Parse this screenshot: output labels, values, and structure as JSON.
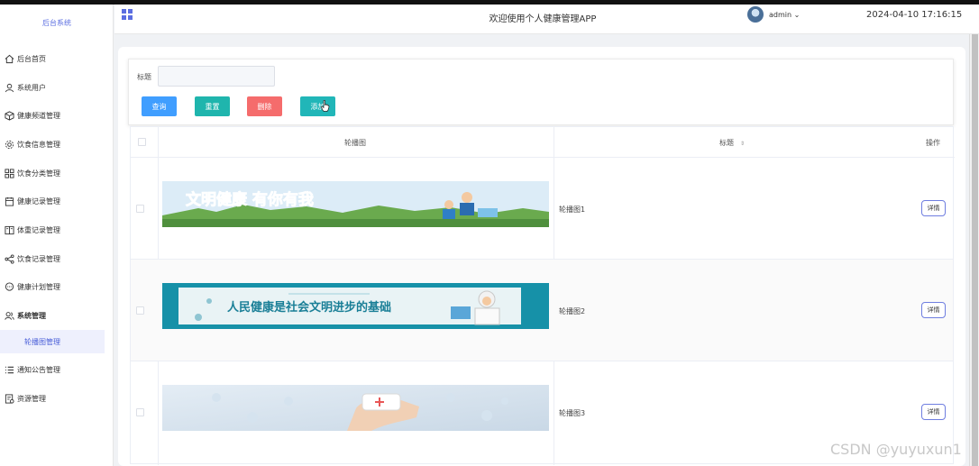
{
  "sidebar": {
    "logo": "后台系统",
    "items": [
      {
        "label": "后台首页",
        "icon": "home-icon"
      },
      {
        "label": "系统用户",
        "icon": "user-icon"
      },
      {
        "label": "健康频道管理",
        "icon": "cube-icon"
      },
      {
        "label": "饮食信息管理",
        "icon": "gear-icon"
      },
      {
        "label": "饮食分类管理",
        "icon": "grid-icon"
      },
      {
        "label": "健康记录管理",
        "icon": "notebook-icon"
      },
      {
        "label": "体重记录管理",
        "icon": "book-icon"
      },
      {
        "label": "饮食记录管理",
        "icon": "share-icon"
      },
      {
        "label": "健康计划管理",
        "icon": "chat-icon"
      },
      {
        "label": "系统管理",
        "icon": "users-icon"
      },
      {
        "label": "轮播图管理",
        "icon": ""
      },
      {
        "label": "通知公告管理",
        "icon": "list-icon"
      },
      {
        "label": "资源管理",
        "icon": "file-icon"
      }
    ]
  },
  "header": {
    "title": "欢迎使用个人健康管理APP",
    "user": "admin",
    "datetime": "2024-04-10 17:16:15"
  },
  "search": {
    "label": "标题",
    "value": "",
    "buttons": {
      "query": "查询",
      "reset": "重置",
      "delete": "删除",
      "add": "添加"
    }
  },
  "table": {
    "columns": [
      "轮播图",
      "标题",
      "操作"
    ],
    "rows": [
      {
        "title": "轮播图1",
        "action": "详情",
        "banner_text": "文明健康 有你有我"
      },
      {
        "title": "轮播图2",
        "action": "详情",
        "banner_text": "人民健康是社会文明进步的基础"
      },
      {
        "title": "轮播图3",
        "action": "详情",
        "banner_text": ""
      }
    ]
  },
  "watermark": "CSDN @yuyuxun1",
  "colors": {
    "accent": "#5b6ee1",
    "query_btn": "#409eff",
    "reset_btn": "#1fb5ad",
    "delete_btn": "#f56c6c",
    "add_btn": "#21b6b8"
  }
}
